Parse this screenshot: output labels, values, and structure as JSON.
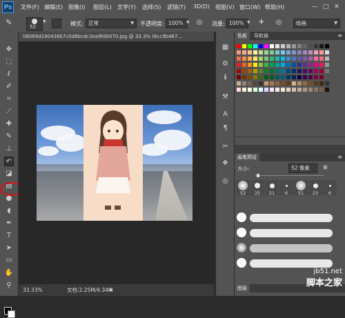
{
  "app": {
    "logo": "Ps"
  },
  "menu": [
    "文件(F)",
    "编辑(E)",
    "图像(I)",
    "图层(L)",
    "文字(Y)",
    "选择(S)",
    "滤镜(T)",
    "3D(D)",
    "视图(V)",
    "窗口(W)",
    "帮助(H)"
  ],
  "window_controls": {
    "minimize": "—",
    "maximize": "□",
    "close": "✕"
  },
  "options": {
    "brush_size": "52",
    "mode_label": "模式:",
    "mode_value": "正常",
    "opacity_label": "不透明度:",
    "opacity_value": "100%",
    "flow_label": "流量:",
    "flow_value": "100%",
    "workspace": "绘画"
  },
  "document": {
    "tab_title": "08069d190436b7c0d6bcdc3ea9fd0070.jpg @ 33.3% (6cc9b467...",
    "zoom": "33.33%",
    "doc_size": "文档:2.25M/4.34M"
  },
  "panels": {
    "swatch_tab": "色板",
    "navigator_tab": "导航器",
    "brush_preset_tab": "画笔预设",
    "size_label": "大小:",
    "size_value": "52 像素",
    "brush_sizes": [
      "52",
      "25",
      "21",
      "6",
      "51",
      "23",
      "6"
    ],
    "layers_tab": "图层"
  },
  "watermark": {
    "line1": "jb51.net",
    "line2": "脚本之家"
  },
  "colors": {
    "accent": "#3aa0ff",
    "highlight": "#e01010",
    "panel": "#535353",
    "canvas_bg": "#282828"
  }
}
